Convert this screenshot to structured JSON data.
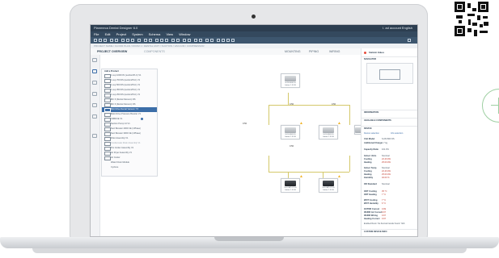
{
  "app": {
    "title": "Planmeca Dental Designer 6.0",
    "user": "I. ad account",
    "language": "English"
  },
  "menu": [
    "File",
    "Edit",
    "Project",
    "System",
    "Schema",
    "View",
    "Window"
  ],
  "breadcrumb": "PROJECT NAME / FLOOR PLAN / ROOM 1 / DENTAL UNIT / SUCTION / VACUUM / COMPRESSOR",
  "tabs": {
    "project_overview": "PROJECT OVERVIEW",
    "secondary": "COMPONENTS",
    "modes": [
      "MOUNTING",
      "PIPING",
      "WIRING"
    ]
  },
  "dropdown": {
    "header": "Add a Product",
    "items": [
      {
        "label": "1 sup 1000 DS (suction/PLC) V1",
        "state": "normal"
      },
      {
        "label": "1 sup 700 DS (suction/PLC) V1",
        "state": "normal"
      },
      {
        "label": "1 sup 500 DS (suction/PLC) V1",
        "state": "normal"
      },
      {
        "label": "1 sup 350 DS (suction/PLC) V1",
        "state": "normal"
      },
      {
        "label": "1 sup 250 DS (suction/PLC) V1",
        "state": "normal"
      },
      {
        "label": "MC 6 (Dental Vacuum) DS",
        "state": "normal"
      },
      {
        "label": "MC 6 (Dental Vacuum) DS",
        "state": "normal"
      },
      {
        "label": "Mini Drive Dental Vacuum 7.5",
        "state": "selected"
      },
      {
        "label": "Mobi Drive Pressure Booster V1",
        "state": "normal"
      },
      {
        "label": "CMM/CE V1",
        "state": "normal"
      },
      {
        "label": "Suction Pump 14 V1",
        "state": "normal"
      },
      {
        "label": "Suct Booster 2000 CE (1Phase)",
        "state": "normal"
      },
      {
        "label": "Suct Booster 3000 CE (1Phase)",
        "state": "normal"
      },
      {
        "label": "Filter Assembly V1",
        "state": "normal"
      },
      {
        "label": "Condensate Drain Assembly V1",
        "state": "disabled"
      },
      {
        "label": "Pre Cooler Assembly V1",
        "state": "normal"
      },
      {
        "label": "Air Dryer Assembly V1",
        "state": "normal"
      },
      {
        "label": "Air Cooler",
        "state": "normal"
      },
      {
        "label": "Water Drain Module",
        "state": "plain"
      },
      {
        "label": "Cyclone",
        "state": "plain"
      }
    ]
  },
  "diagram": {
    "nodes": [
      {
        "id": "top",
        "name": "G-DS 800 DS",
        "sub": "Indoor 1.5 kW"
      },
      {
        "id": "mid1",
        "name": "S-DS 800 DS",
        "sub": "Indoor 1.5 kW"
      },
      {
        "id": "mid2",
        "name": "S-DS 800 DS",
        "sub": "Indoor 1.5 kW"
      },
      {
        "id": "mid3",
        "name": "S-DS 800 DS",
        "sub": "Indoor 1.5 kW"
      },
      {
        "id": "bot1",
        "name": "S-DCMP 67 DS",
        "sub": "Indoor 1.5 kW"
      },
      {
        "id": "bot2",
        "name": "S-DCMP 67 DS",
        "sub": "Indoor 1.5 kW"
      }
    ],
    "dimensions": [
      "0.50",
      "0.50",
      "0.50",
      "0.50"
    ]
  },
  "right_panel": {
    "header": "Statistic Values",
    "navigator_label": "NAVIGATOR",
    "information_label": "INFORMATION",
    "available_components_label": "AVAILABLE COMPONENTS",
    "device_label": "DEVICE",
    "device_tabs": [
      "Device selection",
      "Info selection"
    ],
    "specs": [
      {
        "k": "Unit Model",
        "v": "S-DS 800 DS"
      },
      {
        "k": "Additional Charge",
        "v": "1.7 kg"
      },
      {
        "k": "Capacity Ratio",
        "v": "101.0%"
      },
      {
        "k": "Indoor Units",
        "v": "Nominal"
      },
      {
        "k": "Cooling",
        "v": "22.40 kW"
      },
      {
        "k": "Heating",
        "v": "25.00 kW"
      },
      {
        "k": "Indoor Temp",
        "v": "Nominal"
      },
      {
        "k": "Cooling",
        "v": "22.40 kW"
      },
      {
        "k": "Heating",
        "v": "25.00 kW"
      },
      {
        "k": "Humidity",
        "v": "46.00 %"
      },
      {
        "k": "OD Standard",
        "v": "Nominal"
      },
      {
        "k": "ODT Cooling",
        "v": "35 °C"
      },
      {
        "k": "ODT Heating",
        "v": "7 °C"
      },
      {
        "k": "WOT Cooling",
        "v": "7 °C"
      },
      {
        "k": "WOT Humidity",
        "v": "6 °C"
      },
      {
        "k": "OUTDR Correct",
        "v": "0.99"
      },
      {
        "k": "IDUDR Air Correct",
        "v": "0.97"
      },
      {
        "k": "IDUDR Wiring",
        "v": "0.97"
      },
      {
        "k": "Heating Correct",
        "v": "0.97"
      }
    ],
    "note": "Enabled Room: No thermal transfer found: YES",
    "footer": "CUSTOM DEVICE INFO"
  }
}
